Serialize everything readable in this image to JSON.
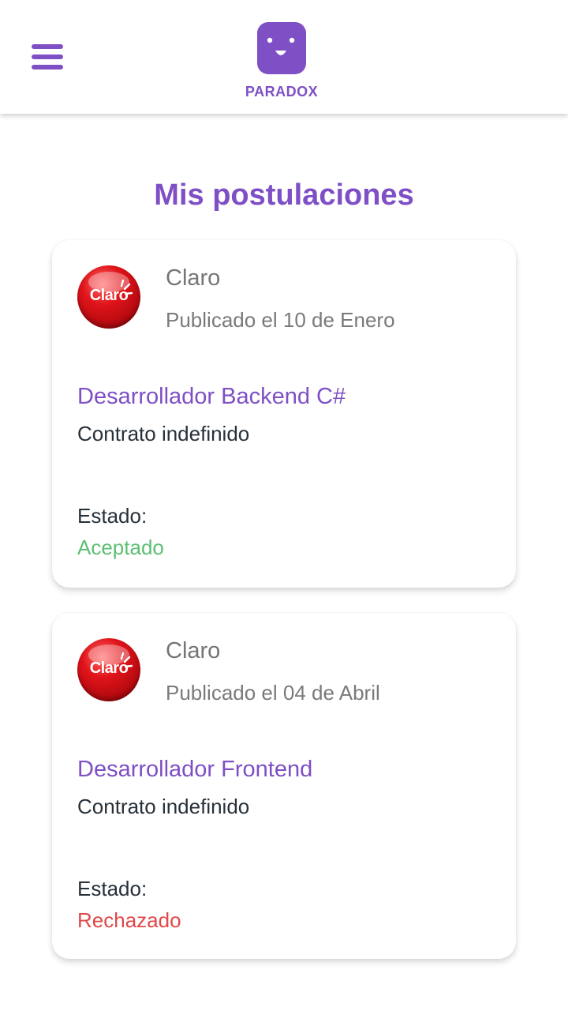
{
  "header": {
    "brand": "PARADOX",
    "menu_icon": "hamburger-menu-icon",
    "logo_icon": "smiling-face-logo-icon",
    "accent_color": "#7e4fc5"
  },
  "page_title": "Mis postulaciones",
  "applications": [
    {
      "company": "Claro",
      "company_logo_text": "Claro",
      "published": "Publicado el 10 de Enero",
      "job_title": "Desarrollador Backend C#",
      "contract": "Contrato indefinido",
      "state_label": "Estado:",
      "state": "Aceptado",
      "state_color": "#5cbf74"
    },
    {
      "company": "Claro",
      "company_logo_text": "Claro",
      "published": "Publicado el 04 de Abril",
      "job_title": "Desarrollador Frontend",
      "contract": "Contrato indefinido",
      "state_label": "Estado:",
      "state": "Rechazado",
      "state_color": "#e04848"
    }
  ]
}
